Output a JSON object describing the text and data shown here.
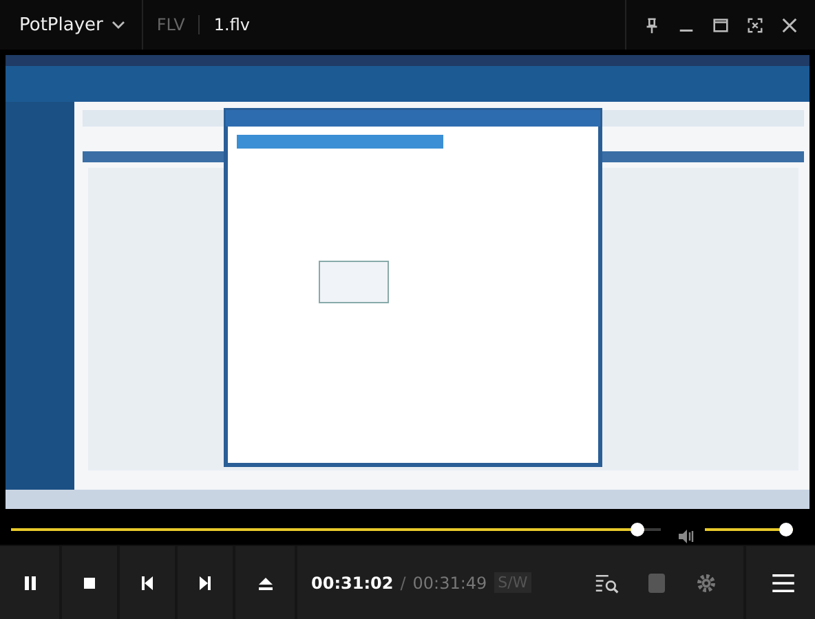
{
  "title_bar": {
    "app_name": "PotPlayer",
    "format": "FLV",
    "file_name": "1.flv"
  },
  "seek": {
    "level": 0.975
  },
  "volume": {
    "level": 1
  },
  "controls": {
    "current_time": "00:31:02",
    "separator": "/",
    "total_time": "00:31:49",
    "badge": "S/W"
  }
}
